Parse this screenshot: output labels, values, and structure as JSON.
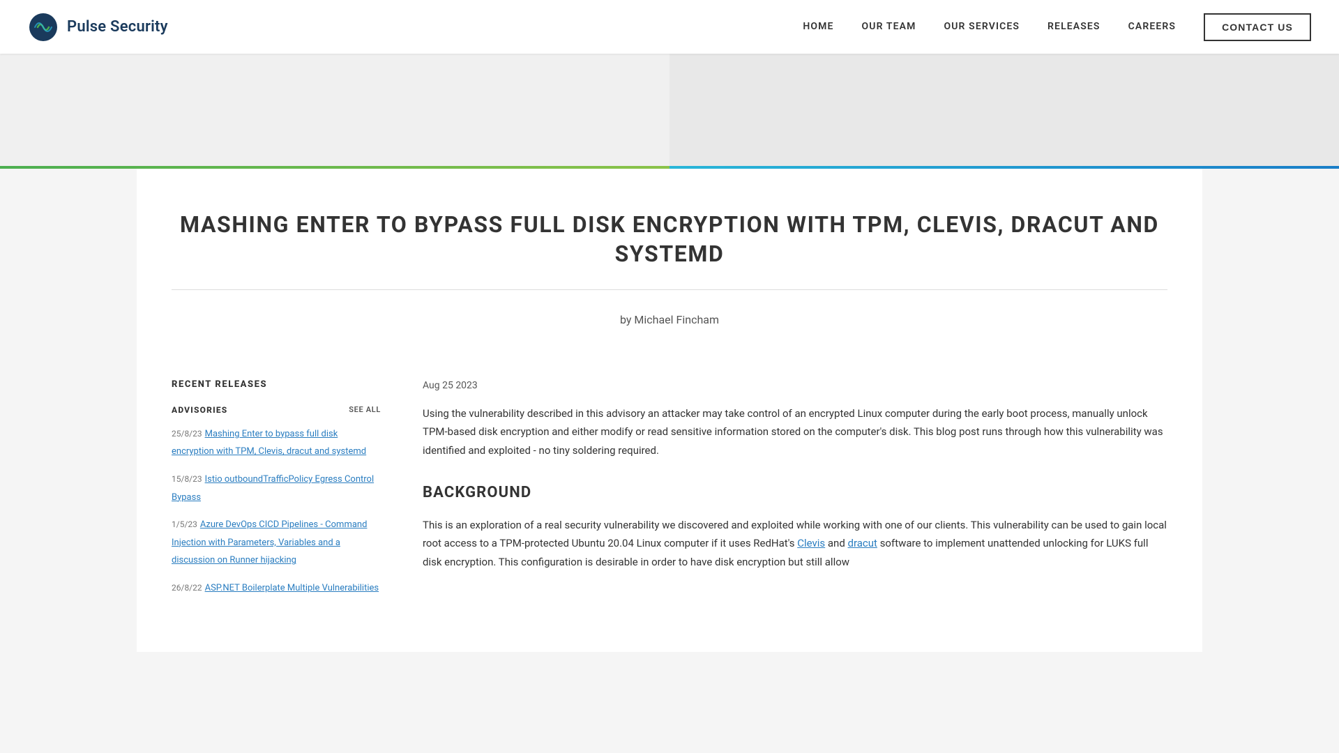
{
  "site": {
    "logo_text": "Pulse Security",
    "logo_icon_alt": "Pulse Security logo"
  },
  "nav": {
    "items": [
      {
        "label": "HOME",
        "href": "#"
      },
      {
        "label": "OUR TEAM",
        "href": "#"
      },
      {
        "label": "OUR SERVICES",
        "href": "#"
      },
      {
        "label": "RELEASES",
        "href": "#"
      },
      {
        "label": "CAREERS",
        "href": "#"
      }
    ],
    "contact_label": "CONTACT US"
  },
  "article": {
    "title": "MASHING ENTER TO BYPASS FULL DISK ENCRYPTION WITH TPM, CLEVIS, DRACUT AND SYSTEMD",
    "byline": "by Michael Fincham",
    "date": "Aug 25 2023",
    "intro": "Using the vulnerability described in this advisory an attacker may take control of an encrypted Linux computer during the early boot process, manually unlock TPM-based disk encryption and either modify or read sensitive information stored on the computer's disk. This blog post runs through how this vulnerability was identified and exploited - no tiny soldering required.",
    "background_heading": "BACKGROUND",
    "background_text": "This is an exploration of a real security vulnerability we discovered and exploited while working with one of our clients. This vulnerability can be used to gain local root access to a TPM-protected Ubuntu 20.04 Linux computer if it uses RedHat's"
  },
  "sidebar": {
    "section_title": "RECENT RELEASES",
    "advisories": {
      "subsection_title": "ADVISORIES",
      "see_all_label": "SEE ALL",
      "items": [
        {
          "date": "25/8/23",
          "label": "Mashing Enter to bypass full disk encryption with TPM, Clevis, dracut and systemd",
          "href": "#"
        },
        {
          "date": "15/8/23",
          "label": "Istio outboundTrafficPolicy Egress Control Bypass",
          "href": "#"
        },
        {
          "date": "1/5/23",
          "label": "Azure DevOps CICD Pipelines - Command Injection with Parameters, Variables and a discussion on Runner hijacking",
          "href": "#"
        },
        {
          "date": "26/8/22",
          "label": "ASP.NET Boilerplate Multiple Vulnerabilities",
          "href": "#"
        }
      ]
    }
  },
  "inline_links": {
    "clevis": "Clevis",
    "dracut": "dracut"
  }
}
